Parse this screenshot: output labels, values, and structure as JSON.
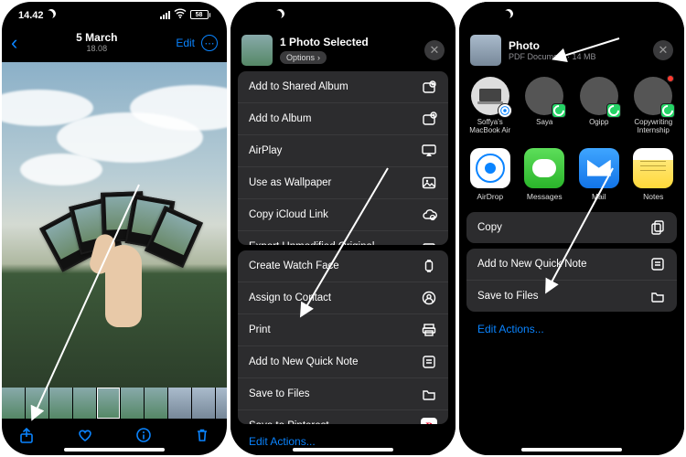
{
  "status": {
    "time": "14.42",
    "battery": "58"
  },
  "phone1": {
    "date": "5 March",
    "time": "18.08",
    "edit": "Edit",
    "more_glyph": "⋯",
    "back_glyph": "‹"
  },
  "phone2": {
    "header_title": "1 Photo Selected",
    "options_label": "Options",
    "close_glyph": "✕",
    "group1": [
      {
        "label": "Add to Shared Album",
        "icon": "shared-album-icon"
      },
      {
        "label": "Add to Album",
        "icon": "album-icon"
      },
      {
        "label": "AirPlay",
        "icon": "airplay-icon"
      },
      {
        "label": "Use as Wallpaper",
        "icon": "wallpaper-icon"
      },
      {
        "label": "Copy iCloud Link",
        "icon": "icloud-link-icon"
      },
      {
        "label": "Export Unmodified Original",
        "icon": "export-icon"
      }
    ],
    "group2": [
      {
        "label": "Create Watch Face",
        "icon": "watch-icon"
      },
      {
        "label": "Assign to Contact",
        "icon": "contact-icon"
      },
      {
        "label": "Print",
        "icon": "print-icon"
      },
      {
        "label": "Add to New Quick Note",
        "icon": "quicknote-icon"
      },
      {
        "label": "Save to Files",
        "icon": "files-icon"
      },
      {
        "label": "Save to Pinterest",
        "icon": "pinterest-icon"
      }
    ],
    "edit_actions": "Edit Actions..."
  },
  "phone3": {
    "header_title": "Photo",
    "header_sub": "PDF Document · 14 MB",
    "close_glyph": "✕",
    "targets": [
      {
        "label": "Soffya's MacBook Air",
        "kind": "mac"
      },
      {
        "label": "Saya",
        "kind": "wa"
      },
      {
        "label": "Ogipp",
        "kind": "wa"
      },
      {
        "label": "Copywriting Internship",
        "kind": "wa-dot"
      }
    ],
    "apps": [
      {
        "label": "AirDrop",
        "icon": "airdrop-app-icon"
      },
      {
        "label": "Messages",
        "icon": "messages-app-icon"
      },
      {
        "label": "Mail",
        "icon": "mail-app-icon"
      },
      {
        "label": "Notes",
        "icon": "notes-app-icon"
      }
    ],
    "group1": [
      {
        "label": "Copy",
        "icon": "copy-icon"
      }
    ],
    "group2": [
      {
        "label": "Add to New Quick Note",
        "icon": "quicknote-icon"
      },
      {
        "label": "Save to Files",
        "icon": "files-icon"
      }
    ],
    "edit_actions": "Edit Actions..."
  }
}
